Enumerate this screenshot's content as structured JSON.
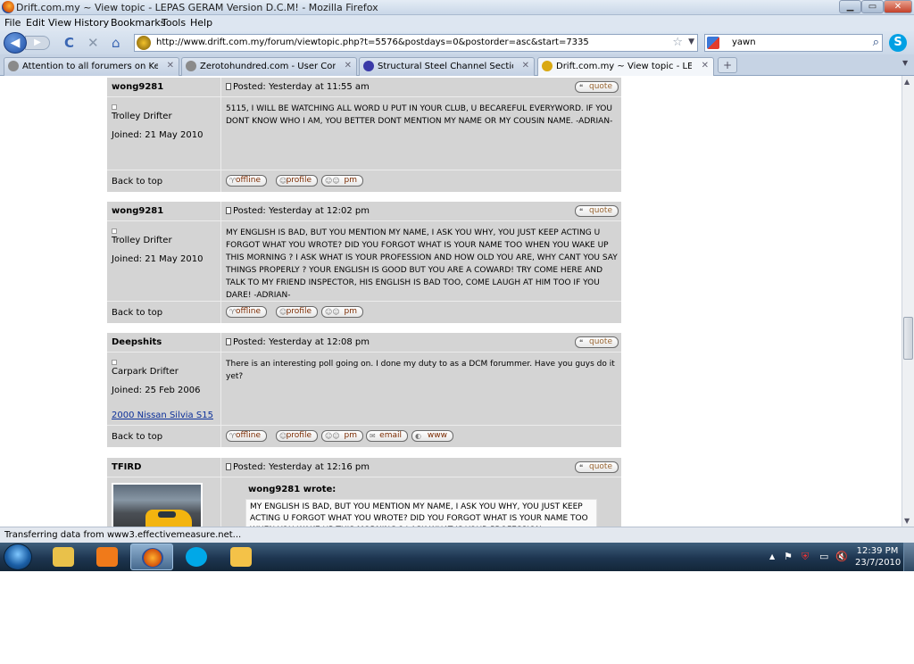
{
  "window": {
    "title": "Drift.com.my ~ View topic - LEPAS GERAM Version D.C.M! - Mozilla Firefox",
    "min_glyph": "▁",
    "max_glyph": "▭",
    "close_glyph": "✕"
  },
  "menu": [
    "File",
    "Edit",
    "View",
    "History",
    "Bookmarks",
    "Tools",
    "Help"
  ],
  "nav": {
    "back_glyph": "◀",
    "forward_glyph": "▶",
    "reload_glyph": "C",
    "stop_glyph": "✕",
    "home_glyph": "⌂",
    "url": "http://www.drift.com.my/forum/viewtopic.php?t=5576&postdays=0&postorder=asc&start=7335",
    "search_query": "yawn",
    "skype_glyph": "S"
  },
  "tabs": [
    {
      "label": "Attention to all forumers on Kendri...",
      "icon_color": "#8a8a8a"
    },
    {
      "label": "Zerotohundred.com - User Control ...",
      "icon_color": "#8a8a8a"
    },
    {
      "label": "Structural Steel Channel Section Pro...",
      "icon_color": "#3a3aa8"
    },
    {
      "label": "Drift.com.my ~ View topic - LEPA...",
      "icon_color": "#d9a812"
    }
  ],
  "new_tab_glyph": "+",
  "tab_close_glyph": "✕",
  "tablist_glyph": "▼",
  "posts": [
    {
      "username": "wong9281",
      "posted": "Posted: Yesterday at 11:55 am",
      "rank": "Trolley Drifter",
      "joined": "Joined: 21 May 2010",
      "body": "5115, I WILL BE WATCHING ALL WORD U PUT IN YOUR CLUB, U BECAREFUL EVERYWORD. IF YOU DONT KNOW WHO I AM, YOU BETTER DONT MENTION MY NAME OR MY COUSIN NAME. -ADRIAN-",
      "buttons": [
        "offline",
        "profile",
        "pm"
      ]
    },
    {
      "username": "wong9281",
      "posted": "Posted: Yesterday at 12:02 pm",
      "rank": "Trolley Drifter",
      "joined": "Joined: 21 May 2010",
      "body": "MY ENGLISH IS BAD, BUT YOU MENTION MY NAME, I ASK YOU WHY, YOU JUST KEEP ACTING U FORGOT WHAT YOU WROTE? DID YOU FORGOT WHAT IS YOUR NAME TOO WHEN YOU WAKE UP THIS MORNING ? I ASK WHAT IS YOUR PROFESSION AND HOW OLD YOU ARE, WHY CANT YOU SAY THINGS PROPERLY ? YOUR ENGLISH IS GOOD BUT YOU ARE A COWARD! TRY COME HERE AND TALK TO MY FRIEND INSPECTOR, HIS ENGLISH IS BAD TOO, COME LAUGH AT HIM TOO IF YOU DARE! -ADRIAN-",
      "buttons": [
        "offline",
        "profile",
        "pm"
      ]
    },
    {
      "username": "Deepshits",
      "posted": "Posted: Yesterday at 12:08 pm",
      "rank": "Carpark Drifter",
      "joined": "Joined: 25 Feb 2006",
      "car": "2000 Nissan Silvia S15",
      "body": "There is an interesting poll going on. I done my duty to as a DCM forummer. Have you guys do it yet?",
      "buttons": [
        "offline",
        "profile",
        "pm",
        "email",
        "www"
      ]
    },
    {
      "username": "TFIRD",
      "posted": "Posted: Yesterday at 12:16 pm",
      "quote_author": "wong9281 wrote:",
      "quote_text": "MY ENGLISH IS BAD, BUT YOU MENTION MY NAME, I ASK YOU WHY, YOU JUST KEEP ACTING U FORGOT WHAT YOU WROTE? DID YOU FORGOT WHAT IS YOUR NAME TOO WHEN YOU WAKE UP THIS MORNING ? I ASK WHAT IS YOUR PROFESSION"
    }
  ],
  "post_labels": {
    "quote": "quote",
    "back_to_top": "Back to top"
  },
  "button_glyphs": {
    "quote": "❝",
    "offline": "♈",
    "profile": "☺",
    "pm": "☺☺",
    "email": "✉",
    "www": "◐"
  },
  "posted_glyph": "▫",
  "status": "Transferring data from www3.effectivemeasure.net...",
  "scroll": {
    "up_glyph": "▲",
    "down_glyph": "▼"
  },
  "taskbar": {
    "items": [
      {
        "name": "explorer",
        "color": "#e9c14a"
      },
      {
        "name": "media-player",
        "color": "#f07a1a"
      },
      {
        "name": "firefox",
        "color": "#e2702a",
        "active": true
      },
      {
        "name": "skype",
        "color": "#00a8e8"
      },
      {
        "name": "outlook",
        "color": "#f4c248"
      }
    ],
    "tray_glyphs": [
      "▲",
      "⚑",
      "⛨",
      "▭",
      "🔇"
    ],
    "time": "12:39 PM",
    "date": "23/7/2010"
  }
}
